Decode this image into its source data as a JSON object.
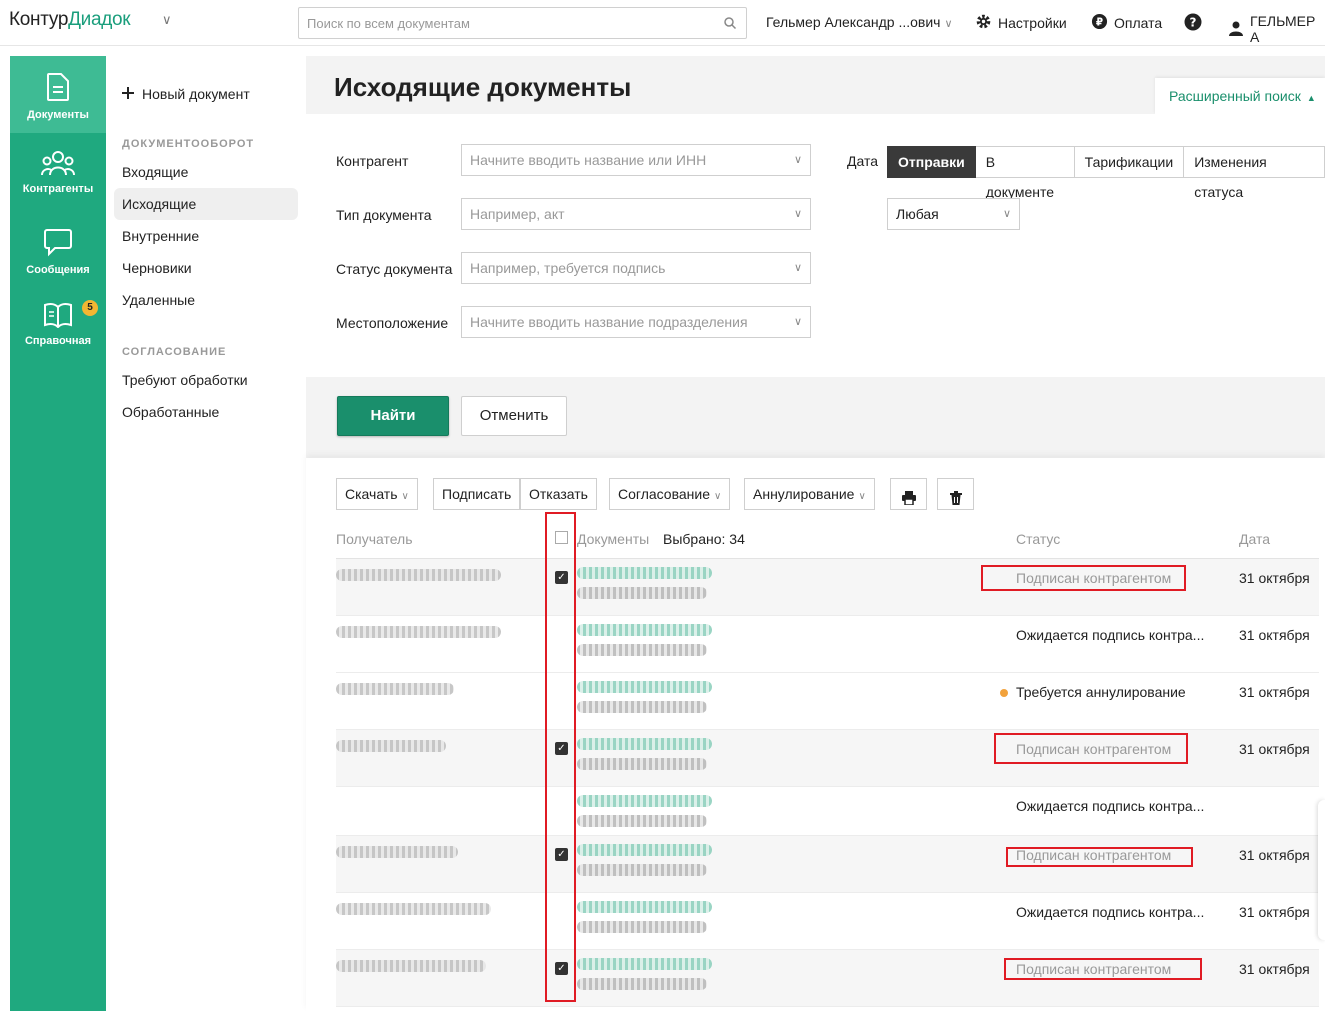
{
  "app": {
    "logo_part1": "Контур",
    "logo_part2": "Диадок"
  },
  "search": {
    "placeholder": "Поиск по всем документам"
  },
  "topbar": {
    "user": "Гельмер Александр ...ович",
    "settings": "Настройки",
    "payment": "Оплата",
    "account": "ГЕЛЬМЕР А"
  },
  "iconbar": [
    {
      "label": "Документы",
      "icon": "document-icon"
    },
    {
      "label": "Контрагенты",
      "icon": "people-icon"
    },
    {
      "label": "Сообщения",
      "icon": "chat-icon"
    },
    {
      "label": "Справочная",
      "icon": "book-icon",
      "badge": "5"
    }
  ],
  "subnav": {
    "new_doc": "Новый документ",
    "section1": "ДОКУМЕНТООБОРОТ",
    "items1": [
      "Входящие",
      "Исходящие",
      "Внутренние",
      "Черновики",
      "Удаленные"
    ],
    "section2": "СОГЛАСОВАНИЕ",
    "items2": [
      "Требуют обработки",
      "Обработанные"
    ]
  },
  "page": {
    "title": "Исходящие документы",
    "advanced_search": "Расширенный поиск"
  },
  "filters": {
    "counterparty": {
      "label": "Контрагент",
      "placeholder": "Начните вводить название или ИНН"
    },
    "doc_type": {
      "label": "Тип документа",
      "placeholder": "Например, акт"
    },
    "doc_status": {
      "label": "Статус документа",
      "placeholder": "Например, требуется подпись"
    },
    "location": {
      "label": "Местоположение",
      "placeholder": "Начните вводить название подразделения"
    },
    "date_label": "Дата",
    "date_tabs": [
      "Отправки",
      "В документе",
      "Тарификации",
      "Изменения статуса"
    ],
    "date_tab_selected": "Отправки",
    "period": "Любая"
  },
  "actions": {
    "find": "Найти",
    "cancel": "Отменить"
  },
  "toolbar": {
    "download": "Скачать",
    "sign": "Подписать",
    "reject": "Отказать",
    "approval": "Согласование",
    "annul": "Аннулирование"
  },
  "table": {
    "col_recipient": "Получатель",
    "col_documents": "Документы",
    "selected": "Выбрано: 34",
    "col_status": "Статус",
    "col_date": "Дата",
    "rows": [
      {
        "checked": true,
        "status": "Подписан контрагентом",
        "date": "31 октября"
      },
      {
        "checked": false,
        "status": "Ожидается подпись контра...",
        "date": "31 октября"
      },
      {
        "checked": false,
        "status": "Требуется аннулирование",
        "date": "31 октября",
        "status_dot": "#f2a23c"
      },
      {
        "checked": true,
        "status": "Подписан контрагентом",
        "date": "31 октября"
      },
      {
        "checked": false,
        "status": "Ожидается подпись контра...",
        "date": ""
      },
      {
        "checked": true,
        "status": "Подписан контрагентом",
        "date": "31 октября"
      },
      {
        "checked": false,
        "status": "Ожидается подпись контра...",
        "date": "31 октября"
      },
      {
        "checked": true,
        "status": "Подписан контрагентом",
        "date": "31 октября"
      }
    ]
  },
  "colors": {
    "brand_green": "#1fa97f",
    "accent_green": "#1a8f6c",
    "highlight_red": "#e01b24"
  }
}
